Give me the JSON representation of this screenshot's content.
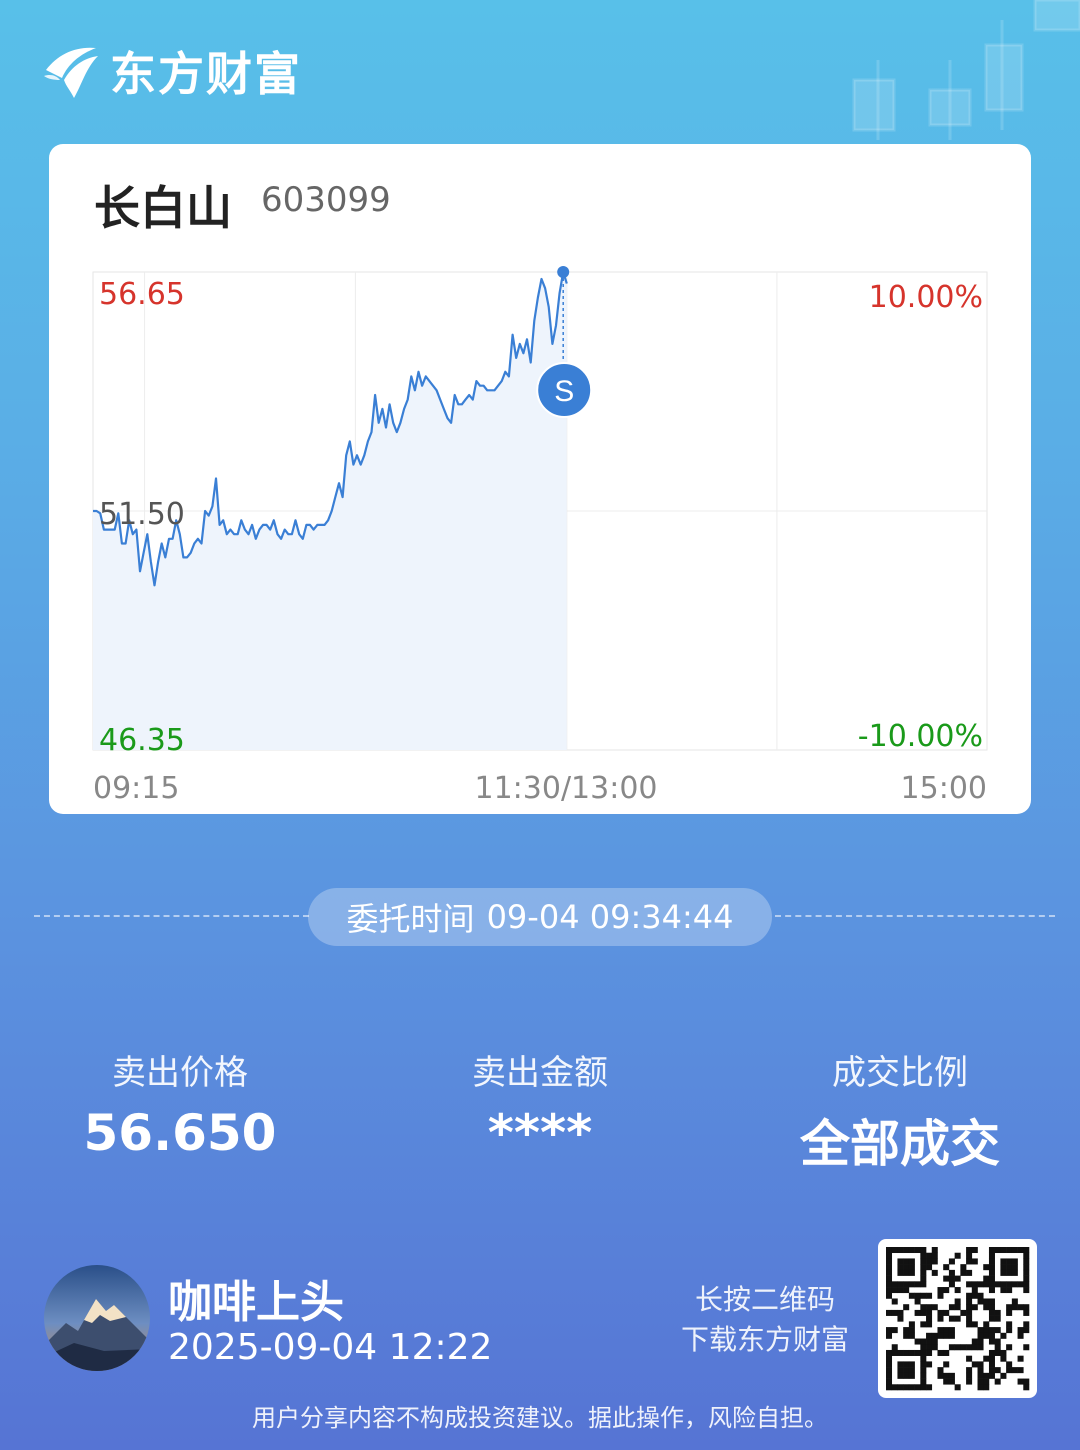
{
  "brand": {
    "name": "东方财富",
    "logo_icon": "east-money-swallow-logo",
    "deco": "candlestick-decoration"
  },
  "stock": {
    "name": "长白山",
    "code": "603099"
  },
  "chart_data": {
    "type": "line",
    "title": "",
    "y_axis_left": [
      "56.65",
      "51.50",
      "46.35"
    ],
    "y_axis_right": [
      "10.00%",
      "-10.00%"
    ],
    "x_ticks": [
      "09:15",
      "11:30/13:00",
      "15:00"
    ],
    "ylim": [
      46.35,
      56.65
    ],
    "prev_close": 51.5,
    "grid": true,
    "colors": {
      "up": "#d6342c",
      "down": "#1a9a1a",
      "line": "#3a7fd5",
      "fill": "#eef4fc"
    },
    "series": [
      {
        "values": [
          51.5,
          51.5,
          51.45,
          51.1,
          51.1,
          51.1,
          51.1,
          51.45,
          50.8,
          50.8,
          51.3,
          51.0,
          51.1,
          50.2,
          50.6,
          51.0,
          50.4,
          49.9,
          50.4,
          50.8,
          50.5,
          50.9,
          50.9,
          51.3,
          51.0,
          50.5,
          50.5,
          50.6,
          50.8,
          50.9,
          50.8,
          51.5,
          51.4,
          51.6,
          52.2,
          51.2,
          51.3,
          51.0,
          51.1,
          51.0,
          51.0,
          51.3,
          51.1,
          51.0,
          51.2,
          50.9,
          51.1,
          51.2,
          51.2,
          51.1,
          51.3,
          51.0,
          50.9,
          51.1,
          51.0,
          51.0,
          51.3,
          51.0,
          50.9,
          51.2,
          51.2,
          51.1,
          51.2,
          51.2,
          51.2,
          51.3,
          51.5,
          51.8,
          52.1,
          51.8,
          52.7,
          53.0,
          52.5,
          52.7,
          52.5,
          52.7,
          53.0,
          53.2,
          54.0,
          53.4,
          53.7,
          53.3,
          53.8,
          53.4,
          53.2,
          53.4,
          53.7,
          53.9,
          54.4,
          54.1,
          54.5,
          54.2,
          54.4,
          54.3,
          54.2,
          54.1,
          53.9,
          53.7,
          53.5,
          53.4,
          54.0,
          53.8,
          53.8,
          53.9,
          54.0,
          53.9,
          54.3,
          54.2,
          54.2,
          54.1,
          54.1,
          54.1,
          54.2,
          54.3,
          54.5,
          54.4,
          55.3,
          54.8,
          55.1,
          54.9,
          55.2,
          54.7,
          55.6,
          56.1,
          56.5,
          56.3,
          55.9,
          55.1,
          55.5,
          56.2,
          56.65,
          56.4
        ]
      }
    ],
    "sell_marker": {
      "label": "S",
      "value": 56.65
    }
  },
  "order": {
    "label": "委托时间",
    "datetime": "09-04 09:34:44"
  },
  "stats": [
    {
      "label": "卖出价格",
      "value": "56.650"
    },
    {
      "label": "卖出金额",
      "value": "****"
    },
    {
      "label": "成交比例",
      "value": "全部成交"
    }
  ],
  "user": {
    "name": "咖啡上头",
    "time": "2025-09-04 12:22",
    "avatar_icon": "snow-mountain-avatar"
  },
  "qr": {
    "hint_line1": "长按二维码",
    "hint_line2": "下载东方财富",
    "icon": "qr-code-icon"
  },
  "disclaimer": "用户分享内容不构成投资建议。据此操作，风险自担。"
}
